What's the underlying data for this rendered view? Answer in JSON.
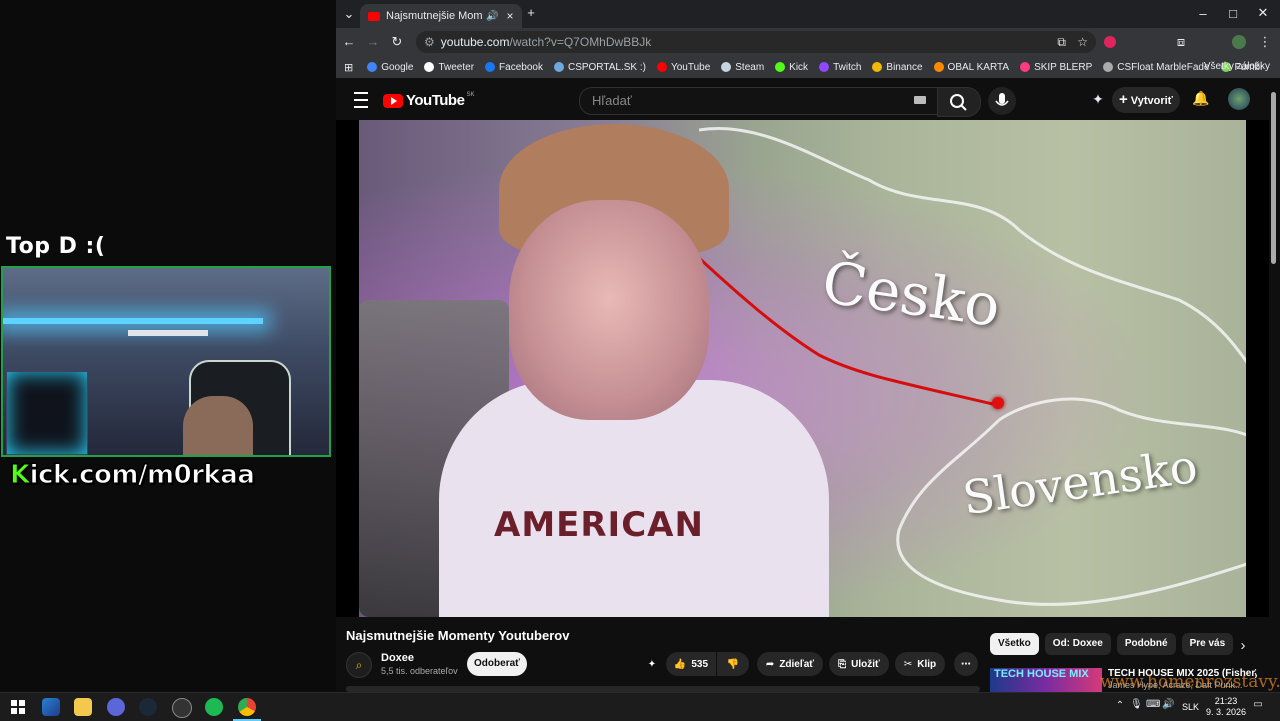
{
  "overlay": {
    "heading": "Top D :(",
    "kick_prefix": "K",
    "kick_rest": "ick.com/m0rkaa"
  },
  "browser": {
    "tab_title": "Najsmutnejšie Momenty Yo",
    "url_host": "youtube.com",
    "url_path": "/watch?v=Q7OMhDwBBJk",
    "new_tab": "+",
    "bookmarks": [
      {
        "label": "Google",
        "color": "#4285f4"
      },
      {
        "label": "Tweeter",
        "color": "#ffffff"
      },
      {
        "label": "Facebook",
        "color": "#1877f2"
      },
      {
        "label": "CSPORTAL.SK :)",
        "color": "#6fa8dc"
      },
      {
        "label": "YouTube",
        "color": "#ff0000"
      },
      {
        "label": "Steam",
        "color": "#c7d5e0"
      },
      {
        "label": "Kick",
        "color": "#53fc18"
      },
      {
        "label": "Twitch",
        "color": "#9146ff"
      },
      {
        "label": "Binance",
        "color": "#f0b90b"
      },
      {
        "label": "OBAL KARTA",
        "color": "#ff8a00"
      },
      {
        "label": "SKIP BLERP",
        "color": "#ff3b7f"
      },
      {
        "label": "CSFloat MarbleFade",
        "color": "#aaaaaa"
      },
      {
        "label": "Fumbi",
        "color": "#7ed957"
      }
    ],
    "all_bookmarks": "Všetky záložky"
  },
  "youtube": {
    "logo_text": "YouTube",
    "logo_country": "SK",
    "search_placeholder": "Hľadať",
    "create_label": "Vytvoriť",
    "video": {
      "title": "Najsmutnejšie Momenty Youtuberov",
      "label_cz": "Česko",
      "label_sk": "Slovensko",
      "shirt_text": "AMERICAN"
    },
    "channel": {
      "name": "Doxee",
      "subscribers": "5,5 tis. odberateľov",
      "subscribe_label": "Odoberať"
    },
    "actions": {
      "likes": "535",
      "share_label": "Zdieľať",
      "save_label": "Uložiť",
      "clip_label": "Klip"
    },
    "chips": [
      "Všetko",
      "Od: Doxee",
      "Podobné",
      "Pre vás"
    ],
    "recommendation": {
      "thumb_text": "TECH HOUSE MIX",
      "title": "TECH HOUSE MIX 2025  (Fisher,",
      "subtitle": "James Hype, Acraze, Daft Punk..."
    },
    "watermark": "www.homenrozstavy.sk"
  },
  "taskbar": {
    "language": "SLK",
    "time": "21:23",
    "date": "9. 3. 2026"
  }
}
